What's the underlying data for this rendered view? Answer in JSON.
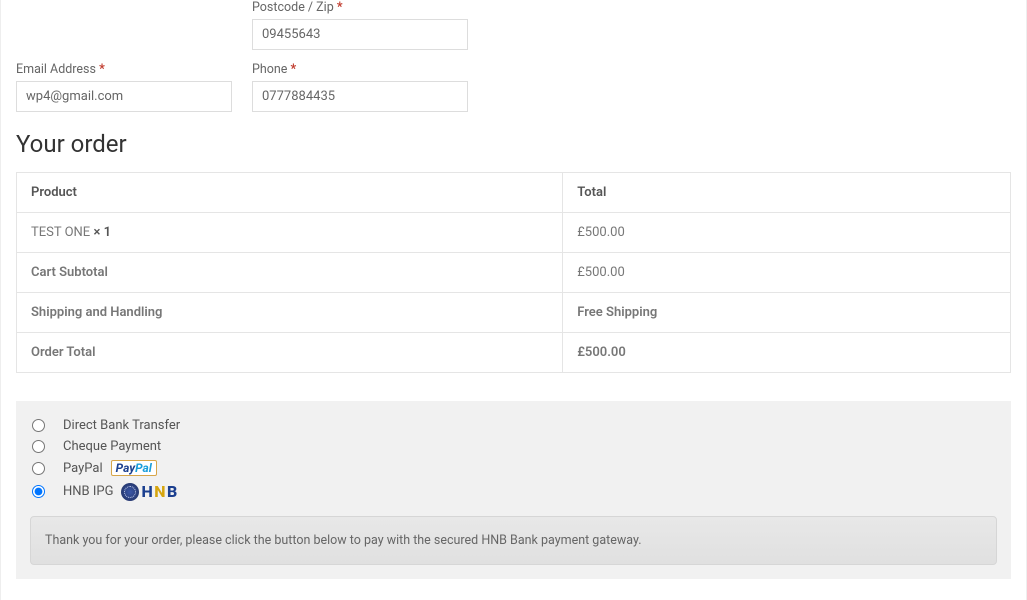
{
  "billing": {
    "postcode_label": "Postcode / Zip",
    "postcode_value": "09455643",
    "email_label": "Email Address",
    "email_value": "wp4@gmail.com",
    "phone_label": "Phone",
    "phone_value": "0777884435",
    "required_mark": "*"
  },
  "order": {
    "heading": "Your order",
    "columns": {
      "product": "Product",
      "total": "Total"
    },
    "items": [
      {
        "name": "TEST ONE",
        "qty_prefix": "× ",
        "qty": "1",
        "total": "£500.00"
      }
    ],
    "subtotal_label": "Cart Subtotal",
    "subtotal_value": "£500.00",
    "shipping_label": "Shipping and Handling",
    "shipping_value": "Free Shipping",
    "order_total_label": "Order Total",
    "order_total_value": "£500.00"
  },
  "payment": {
    "methods": {
      "bank": "Direct Bank Transfer",
      "cheque": "Cheque Payment",
      "paypal": "PayPal",
      "hnb": "HNB IPG"
    },
    "selected": "hnb",
    "paypal_badge": {
      "pay": "Pay",
      "pal": "Pal"
    },
    "hnb_badge": {
      "h": "H",
      "n": "N",
      "b": "B"
    },
    "gateway_message": "Thank you for your order, please click the button below to pay with the secured HNB Bank payment gateway."
  }
}
